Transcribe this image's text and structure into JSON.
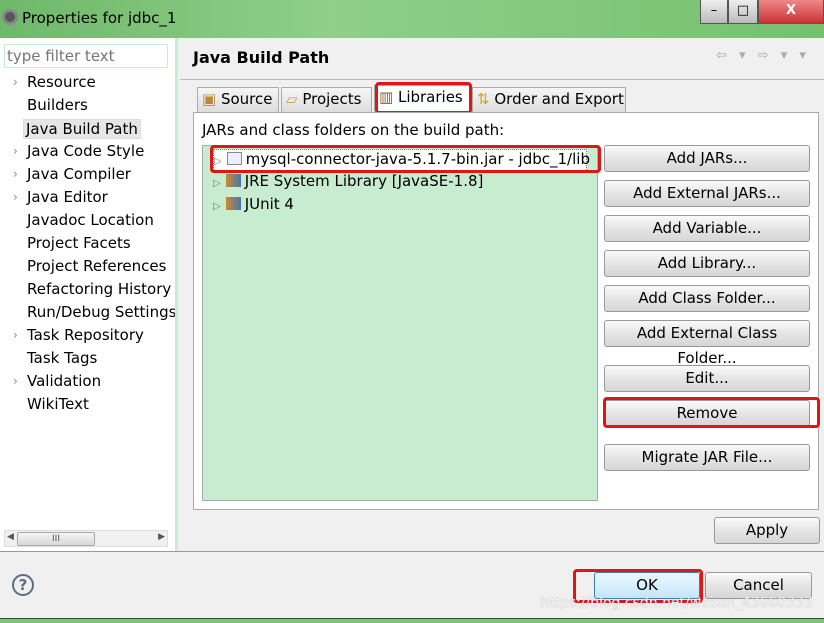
{
  "window": {
    "title": "Properties for jdbc_1",
    "minimize": "–",
    "maximize": "□",
    "close": "X"
  },
  "sidebar": {
    "filter_placeholder": "type filter text",
    "items": [
      {
        "label": "Resource",
        "expandable": true
      },
      {
        "label": "Builders",
        "expandable": false
      },
      {
        "label": "Java Build Path",
        "expandable": false,
        "selected": true
      },
      {
        "label": "Java Code Style",
        "expandable": true
      },
      {
        "label": "Java Compiler",
        "expandable": true
      },
      {
        "label": "Java Editor",
        "expandable": true
      },
      {
        "label": "Javadoc Location",
        "expandable": false
      },
      {
        "label": "Project Facets",
        "expandable": false
      },
      {
        "label": "Project References",
        "expandable": false
      },
      {
        "label": "Refactoring History",
        "expandable": false
      },
      {
        "label": "Run/Debug Settings",
        "expandable": false
      },
      {
        "label": "Task Repository",
        "expandable": true
      },
      {
        "label": "Task Tags",
        "expandable": false
      },
      {
        "label": "Validation",
        "expandable": true
      },
      {
        "label": "WikiText",
        "expandable": false
      }
    ],
    "scroll_thumb": "III"
  },
  "page": {
    "title": "Java Build Path",
    "nav": "⇦ ▾ ⇨ ▾ ▾"
  },
  "tabs": [
    {
      "label": "Source"
    },
    {
      "label": "Projects"
    },
    {
      "label": "Libraries",
      "active": true
    },
    {
      "label": "Order and Export"
    }
  ],
  "libraries": {
    "label": "JARs and class folders on the build path:",
    "entries": [
      {
        "label": "mysql-connector-java-5.1.7-bin.jar - jdbc_1/lib",
        "selected": true
      },
      {
        "label": "JRE System Library [JavaSE-1.8]"
      },
      {
        "label": "JUnit 4"
      }
    ]
  },
  "buttons": {
    "add_jars": "Add JARs...",
    "add_external_jars": "Add External JARs...",
    "add_variable": "Add Variable...",
    "add_library": "Add Library...",
    "add_class_folder": "Add Class Folder...",
    "add_external_class_folder": "Add External Class Folder...",
    "edit": "Edit...",
    "remove": "Remove",
    "migrate": "Migrate JAR File...",
    "apply": "Apply",
    "ok": "OK",
    "cancel": "Cancel",
    "help": "?"
  },
  "watermark": "https://blog.csdn.net/weixin_43660333",
  "colors": {
    "highlight": "#e01515",
    "list_bg": "#c8ecd0"
  }
}
